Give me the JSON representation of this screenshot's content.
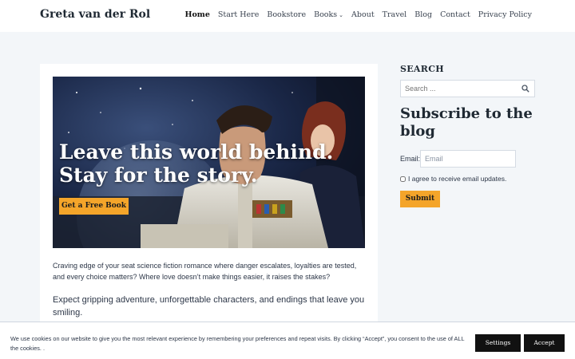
{
  "site": {
    "title": "Greta van der Rol"
  },
  "nav": {
    "items": [
      {
        "label": "Home"
      },
      {
        "label": "Start Here"
      },
      {
        "label": "Bookstore"
      },
      {
        "label": "Books"
      },
      {
        "label": "About"
      },
      {
        "label": "Travel"
      },
      {
        "label": "Blog"
      },
      {
        "label": "Contact"
      },
      {
        "label": "Privacy Policy"
      }
    ],
    "active": "Home"
  },
  "hero": {
    "headline_line1": "Leave this world behind.",
    "headline_line2": "Stay for the story.",
    "cta": "Get a Free Book"
  },
  "main": {
    "intro": "Craving edge of your seat science fiction romance where danger escalates, loyalties are tested, and every choice matters? Where love doesn’t make things easier, it raises the stakes?",
    "expect": "Expect gripping adventure, unforgettable characters, and endings that leave you smiling."
  },
  "sidebar": {
    "search_title": "SEARCH",
    "search_placeholder": "Search ...",
    "subscribe_title": "Subscribe to the blog",
    "email_label": "Email:",
    "email_placeholder": "Email",
    "agree_text": "I agree to receive email updates.",
    "submit": "Submit"
  },
  "cookie": {
    "text": "We use cookies on our website to give you the most relevant experience by remembering your preferences and repeat visits. By clicking “Accept”, you consent to the use of ALL the cookies. .",
    "settings": "Settings",
    "accept": "Accept"
  },
  "colors": {
    "accent": "#f4a52a",
    "page_bg": "#f3f6f9",
    "button_dark": "#111111"
  },
  "icons": {
    "search": "search-icon",
    "books_dropdown": "chevron-down-icon"
  }
}
